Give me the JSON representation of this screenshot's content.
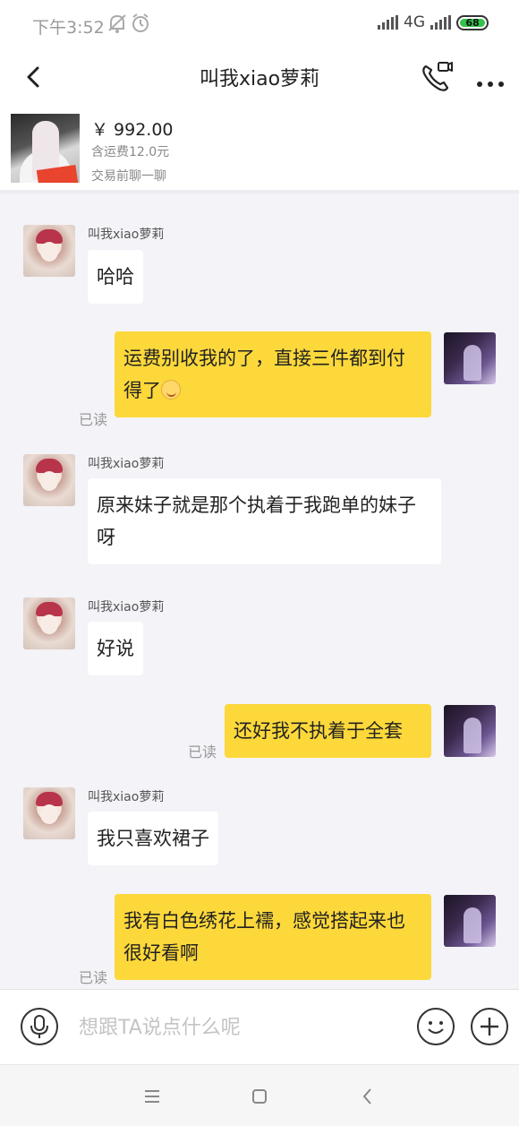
{
  "status_bar": {
    "time": "下午3:52",
    "network": "4G",
    "battery": "68",
    "icons": [
      "bell-mute-icon",
      "alarm-icon",
      "signal-icon",
      "battery-icon"
    ]
  },
  "header": {
    "title": "叫我xiao萝莉",
    "icons": [
      "back-arrow-icon",
      "video-call-icon",
      "more-icon"
    ]
  },
  "product": {
    "price": "￥ 992.00",
    "shipping": "含运费12.0元",
    "chat_tip": "交易前聊一聊"
  },
  "messages": [
    {
      "from": "other",
      "sender": "叫我xiao萝莉",
      "text": "哈哈"
    },
    {
      "from": "me",
      "text": "运费别收我的了，直接三件都到付得了",
      "emoji": "smile-emoji",
      "read": "已读"
    },
    {
      "from": "other",
      "sender": "叫我xiao萝莉",
      "text": "原来妹子就是那个执着于我跑单的妹子呀"
    },
    {
      "from": "other",
      "sender": "叫我xiao萝莉",
      "text": "好说"
    },
    {
      "from": "me",
      "text": "还好我不执着于全套",
      "read": "已读"
    },
    {
      "from": "other",
      "sender": "叫我xiao萝莉",
      "text": "我只喜欢裙子"
    },
    {
      "from": "me",
      "text": "我有白色绣花上襦，感觉搭起来也很好看啊",
      "read": "已读"
    }
  ],
  "input_bar": {
    "placeholder": "想跟TA说点什么呢",
    "icons": [
      "microphone-icon",
      "emoji-face-icon",
      "plus-icon"
    ]
  },
  "nav_bar": {
    "icons": [
      "menu-icon",
      "home-square-icon",
      "back-chevron-icon"
    ]
  }
}
